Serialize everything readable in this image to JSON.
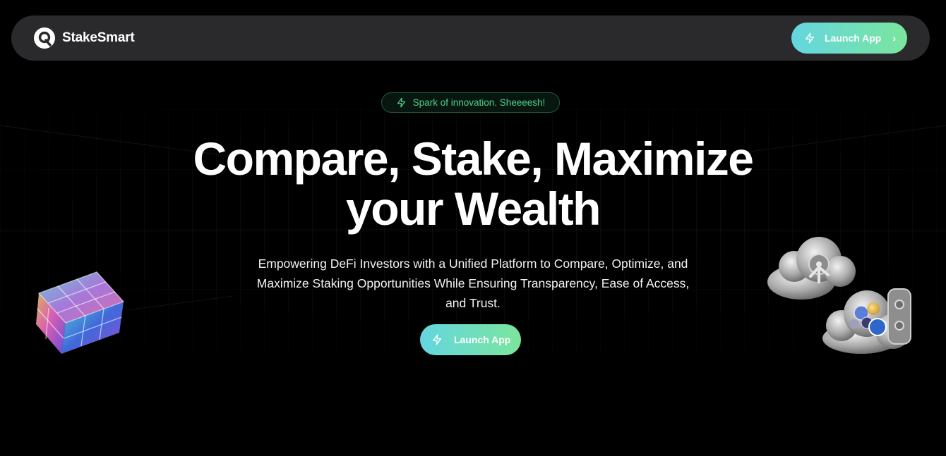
{
  "brand": {
    "name": "StakeSmart",
    "logo_icon": "stakesmart-logo-icon"
  },
  "nav": {
    "launch_label": "Launch App",
    "launch_icon": "lightning-bolt-icon",
    "chevron_glyph": "›"
  },
  "badge": {
    "text": "Spark of innovation. Sheeeesh!",
    "icon": "lightning-bolt-icon"
  },
  "hero": {
    "title_line1": "Compare, Stake, Maximize",
    "title_line2": "your Wealth",
    "subtitle_line1": "Empowering DeFi Investors with a Unified Platform to Compare, Optimize, and",
    "subtitle_line2": "Maximize Staking Opportunities While Ensuring Transparency, Ease of Access,",
    "subtitle_line3": "and Trust.",
    "cta_label": "Launch App",
    "cta_icon": "lightning-bolt-icon"
  },
  "colors": {
    "background": "#000000",
    "navbar": "#2a2a2c",
    "accent_gradient_start": "#64d6e0",
    "accent_gradient_end": "#7be59d",
    "badge_text": "#4fd08b",
    "badge_border": "#1f5a3b"
  }
}
